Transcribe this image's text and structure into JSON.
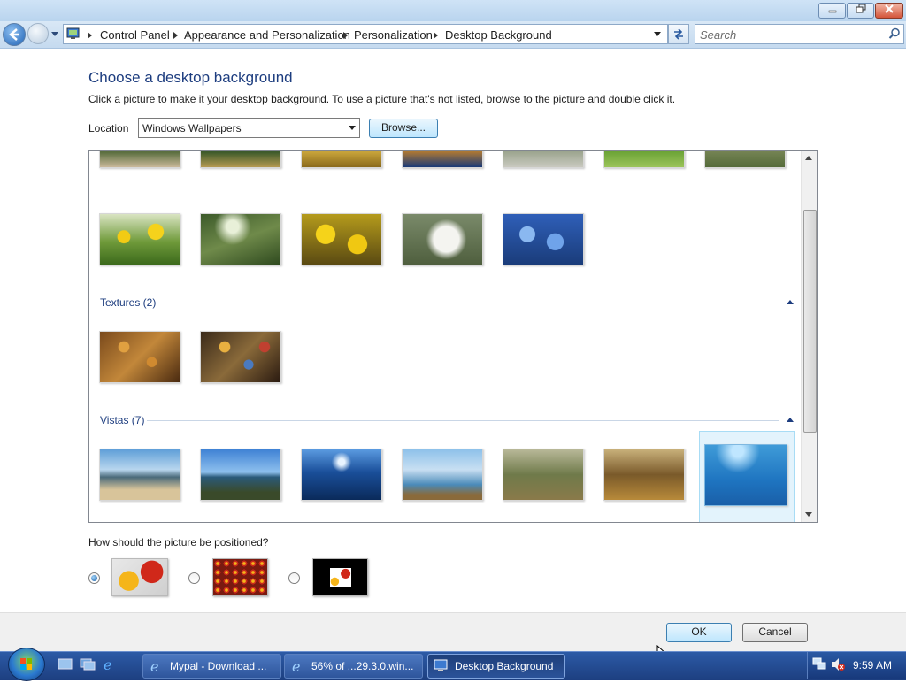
{
  "window": {
    "breadcrumb": [
      "Control Panel",
      "Appearance and Personalization",
      "Personalization",
      "Desktop Background"
    ],
    "search_placeholder": "Search"
  },
  "content": {
    "heading": "Choose a desktop background",
    "subtitle": "Click a picture to make it your desktop background. To use a picture that's not listed, browse to the picture and double click it.",
    "location_label": "Location",
    "location_value": "Windows Wallpapers",
    "browse_label": "Browse...",
    "groups": [
      {
        "label": "Textures (2)"
      },
      {
        "label": "Vistas (7)"
      }
    ],
    "position_question": "How should the picture be positioned?",
    "position_options": [
      "fit-to-screen",
      "tile",
      "center"
    ],
    "position_selected": "fit-to-screen"
  },
  "footer": {
    "ok_label": "OK",
    "cancel_label": "Cancel"
  },
  "taskbar": {
    "items": [
      {
        "label": "Mypal - Download ...",
        "icon": "ie-icon"
      },
      {
        "label": "56% of ...29.3.0.win...",
        "icon": "ie-icon"
      },
      {
        "label": "Desktop Background",
        "icon": "monitor-icon",
        "active": true
      }
    ],
    "clock": "9:59 AM"
  },
  "colors": {
    "accent": "#1d3d7f",
    "taskbar": "#2c5aa6",
    "selection": "#e3f3fc"
  }
}
